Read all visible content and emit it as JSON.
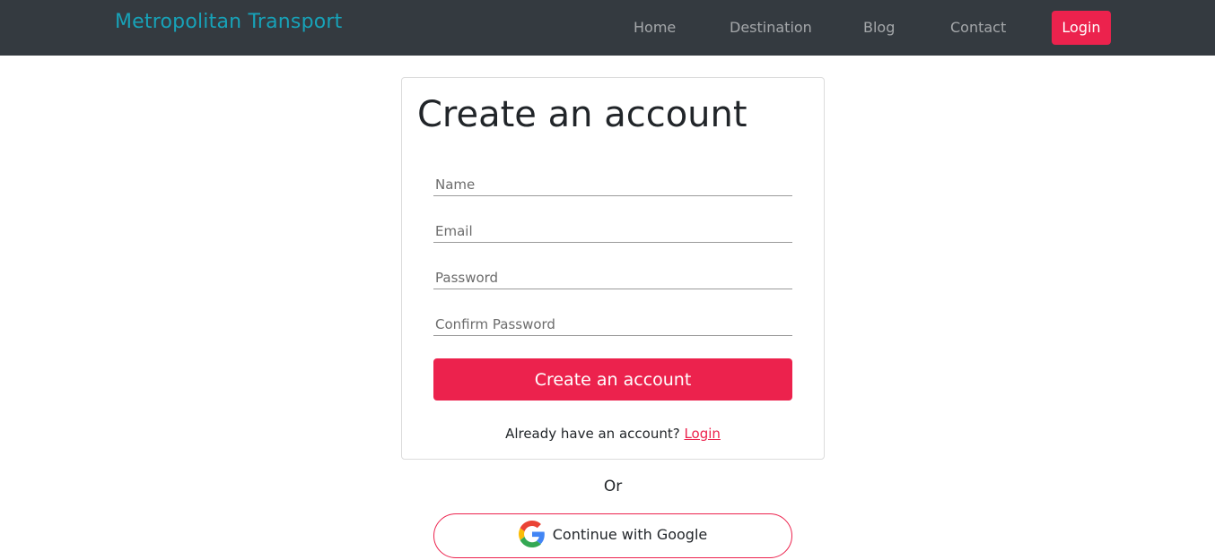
{
  "navbar": {
    "brand": "Metropolitan Transport",
    "links": [
      "Home",
      "Destination",
      "Blog",
      "Contact"
    ],
    "login_label": "Login"
  },
  "form": {
    "title": "Create an account",
    "fields": {
      "name_placeholder": "Name",
      "email_placeholder": "Email",
      "password_placeholder": "Password",
      "confirm_placeholder": "Confirm Password"
    },
    "submit_label": "Create an account",
    "already_text": "Already have an account?",
    "login_link": "Login"
  },
  "alt": {
    "or_text": "Or",
    "google_label": "Continue with Google",
    "google_icon": "google-g-logo"
  },
  "colors": {
    "navbar_bg": "#343a40",
    "brand": "#17a2b8",
    "accent": "#ec224d"
  }
}
